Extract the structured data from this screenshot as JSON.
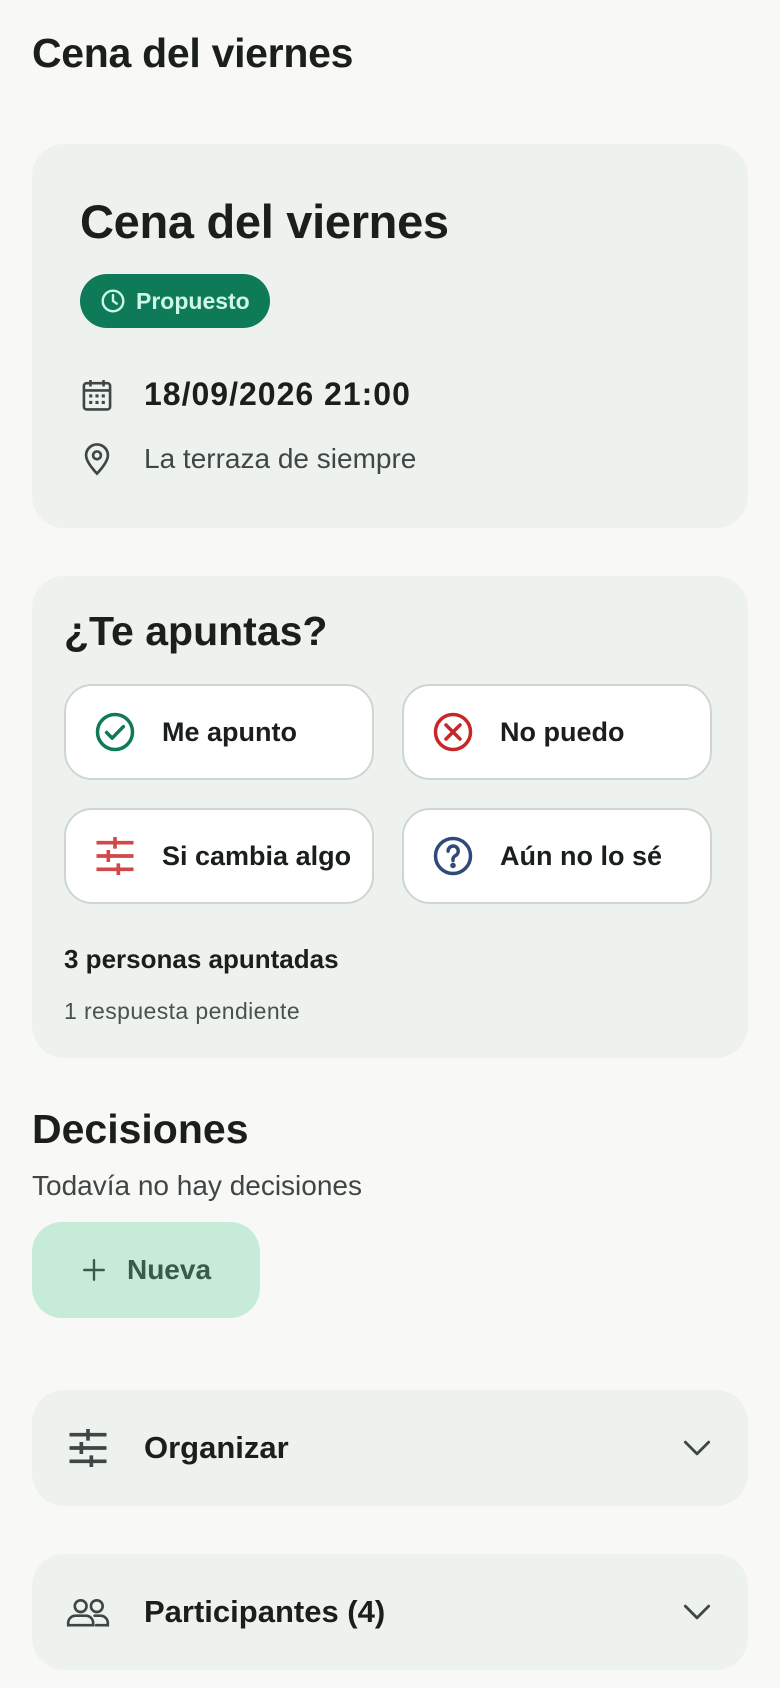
{
  "header": {
    "title": "Cena del viernes"
  },
  "event": {
    "title": "Cena del viernes",
    "status": "Propuesto",
    "datetime": "18/09/2026 21:00",
    "place": "La terraza de siempre"
  },
  "rsvp": {
    "title": "¿Te apuntas?",
    "options": [
      {
        "label": "Me apunto",
        "icon": "check-circle-icon",
        "color": "#0e7a58"
      },
      {
        "label": "No puedo",
        "icon": "x-circle-icon",
        "color": "#c62828"
      },
      {
        "label": "Si cambia algo",
        "icon": "sliders-icon",
        "color": "#d04848"
      },
      {
        "label": "Aún no lo sé",
        "icon": "question-circle-icon",
        "color": "#2f4a78"
      }
    ],
    "count_text": "3 personas apuntadas",
    "pending_text": "1 respuesta pendiente"
  },
  "decisions": {
    "title": "Decisiones",
    "empty_text": "Todavía no hay decisiones",
    "new_button_label": "Nueva"
  },
  "sections": {
    "organize_label": "Organizar",
    "participants_label": "Participantes (4)"
  },
  "colors": {
    "accent": "#0e7a58",
    "accent_light": "#c6ecd9",
    "card_bg": "#eef2ee",
    "page_bg": "#f8f9f6"
  }
}
